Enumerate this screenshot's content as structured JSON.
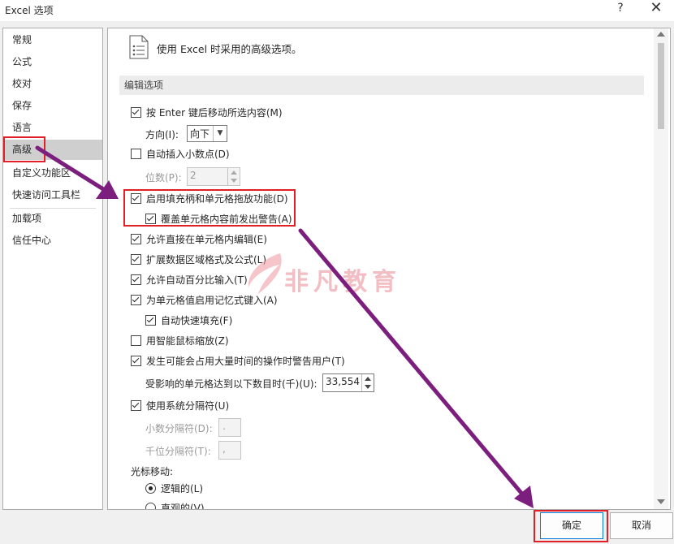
{
  "window": {
    "title": "Excel 选项",
    "help_glyph": "?",
    "close_glyph": "✕"
  },
  "sidebar": {
    "items": [
      {
        "label": "常规"
      },
      {
        "label": "公式"
      },
      {
        "label": "校对"
      },
      {
        "label": "保存"
      },
      {
        "label": "语言"
      },
      {
        "label": "高级",
        "selected": true
      },
      {
        "label": "自定义功能区"
      },
      {
        "label": "快速访问工具栏"
      },
      {
        "label": "加载项"
      },
      {
        "label": "信任中心"
      }
    ]
  },
  "main": {
    "heading": "使用 Excel 时采用的高级选项。",
    "section_title": "编辑选项",
    "options": {
      "move_after_enter": {
        "label": "按 Enter 键后移动所选内容(M)",
        "checked": true
      },
      "direction": {
        "label": "方向(I):",
        "value": "向下"
      },
      "auto_decimal": {
        "label": "自动插入小数点(D)",
        "checked": false
      },
      "places": {
        "label": "位数(P):",
        "value": "2"
      },
      "fill_handle": {
        "label": "启用填充柄和单元格拖放功能(D)",
        "checked": true
      },
      "alert_overwrite": {
        "label": "覆盖单元格内容前发出警告(A)",
        "checked": true
      },
      "edit_in_cell": {
        "label": "允许直接在单元格内编辑(E)",
        "checked": true
      },
      "extend_formats": {
        "label": "扩展数据区域格式及公式(L)",
        "checked": true
      },
      "auto_percent": {
        "label": "允许自动百分比输入(T)",
        "checked": true
      },
      "autocomplete": {
        "label": "为单元格值启用记忆式键入(A)",
        "checked": true
      },
      "flash_fill": {
        "label": "自动快速填充(F)",
        "checked": true
      },
      "zoom_roll": {
        "label": "用智能鼠标缩放(Z)",
        "checked": false
      },
      "alert_slow": {
        "label": "发生可能会占用大量时间的操作时警告用户(T)",
        "checked": true
      },
      "cells_threshold": {
        "label": "受影响的单元格达到以下数目时(千)(U):",
        "value": "33,554"
      },
      "system_separators": {
        "label": "使用系统分隔符(U)",
        "checked": true
      },
      "decimal_sep": {
        "label": "小数分隔符(D):",
        "value": "."
      },
      "thousands_sep": {
        "label": "千位分隔符(T):",
        "value": ","
      },
      "cursor_move": {
        "label": "光标移动:"
      },
      "logical": {
        "label": "逻辑的(L)",
        "selected": true
      },
      "visual": {
        "label": "直观的(V)",
        "selected": false
      }
    }
  },
  "footer": {
    "ok": "确定",
    "cancel": "取消"
  },
  "watermark": {
    "text": "非凡教育"
  },
  "colors": {
    "highlight": "#e21f26",
    "arrow": "#7b1e7e",
    "selected_item": "#cfcfcf"
  }
}
